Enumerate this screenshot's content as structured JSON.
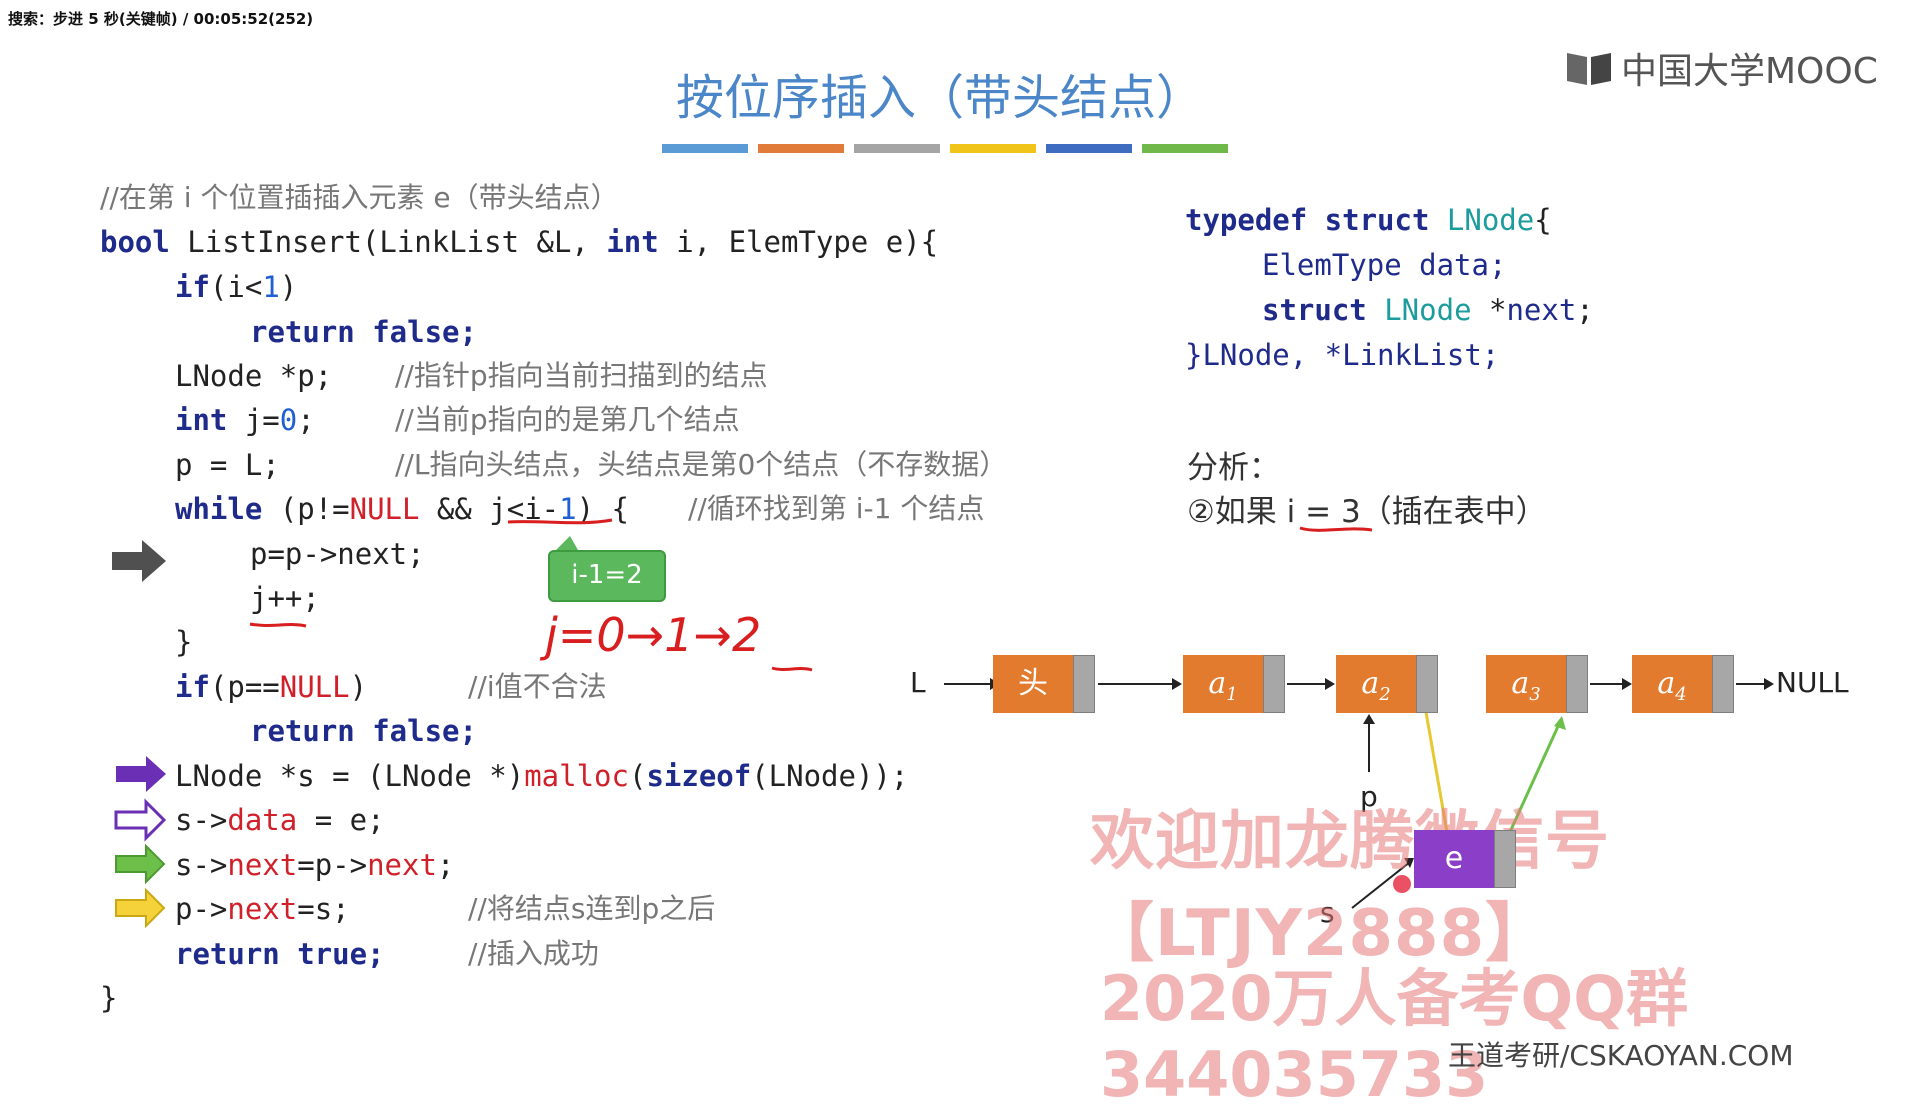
{
  "player": {
    "status": "搜索：步进 5 秒(关键帧) / 00:05:52(252)"
  },
  "slide": {
    "title": "按位序插入（带头结点）",
    "logo_text": "中国大学MOOC",
    "color_bar": [
      "#5b9bd5",
      "#e07b39",
      "#a5a5a5",
      "#f0c419",
      "#3d6cc0",
      "#70b84a"
    ],
    "code": {
      "comment_header": "//在第 i 个位置插插入元素 e（带头结点）",
      "l1_bool": "bool",
      "l1_rest": " ListInsert(LinkList &L, ",
      "l1_int": "int",
      "l1_i": " i, ElemType e){",
      "l2_if": "if",
      "l2_a": "(i<",
      "l2_num": "1",
      "l2_b": ")",
      "l3": "return false;",
      "l4_code": "LNode *p;",
      "l4_cm": "//指针p指向当前扫描到的结点",
      "l5_int": "int",
      "l5_a": " j=",
      "l5_num": "0",
      "l5_b": ";",
      "l5_cm": "//当前p指向的是第几个结点",
      "l6_code": "p = L;",
      "l6_cm": "//L指向头结点，头结点是第0个结点（不存数据）",
      "l7_while": "while",
      "l7_a": " (p!=",
      "l7_null": "NULL",
      "l7_b": " && j<i-",
      "l7_num": "1",
      "l7_c": ") {",
      "l7_cm": "//循环找到第 i-1 个结点",
      "l8": "p=p->next;",
      "l9": "j++;",
      "l10": "}",
      "l11_if": "if",
      "l11_a": "(p==",
      "l11_null": "NULL",
      "l11_b": ")",
      "l11_cm": "//i值不合法",
      "l12": "return false;",
      "l13_a": "LNode *s = (LNode *)",
      "l13_malloc": "malloc",
      "l13_b": "(",
      "l13_sizeof": "sizeof",
      "l13_c": "(LNode));",
      "l14_a": "s->",
      "l14_data": "data",
      "l14_b": " = e;",
      "l15_a": "s->",
      "l15_next1": "next",
      "l15_b": "=p->",
      "l15_next2": "next",
      "l15_c": ";",
      "l16_a": "p->",
      "l16_next": "next",
      "l16_b": "=s;",
      "l16_cm": "//将结点s连到p之后",
      "l17": "return true;",
      "l17_cm": "//插入成功",
      "l18": "}"
    },
    "struct_def": {
      "s1_typedef": "typedef struct",
      "s1_name": " LNode",
      "s1_brace": "{",
      "s2": "ElemType data;",
      "s3_struct": "struct",
      "s3_name": " LNode",
      "s3_ptr": " *",
      "s3_next": "next",
      "s3_semi": ";",
      "s4": "}LNode, *LinkList;"
    },
    "analysis": {
      "heading": "分析：",
      "case": "②如果 i = 3（插在表中）"
    },
    "tooltip": "i-1=2",
    "handwriting": "j=0→1→2",
    "diagram": {
      "L_label": "L",
      "head": "头",
      "a1": "a",
      "a1_sub": "1",
      "a2": "a",
      "a2_sub": "2",
      "a3": "a",
      "a3_sub": "3",
      "a4": "a",
      "a4_sub": "4",
      "null": "NULL",
      "p_label": "p",
      "s_label": "s",
      "e_label": "e"
    },
    "watermark1": "欢迎加龙腾微信号【LTJY2888】",
    "watermark2": "2020万人备考QQ群  344035733",
    "footer": "王道考研/CSKAOYAN.COM"
  }
}
